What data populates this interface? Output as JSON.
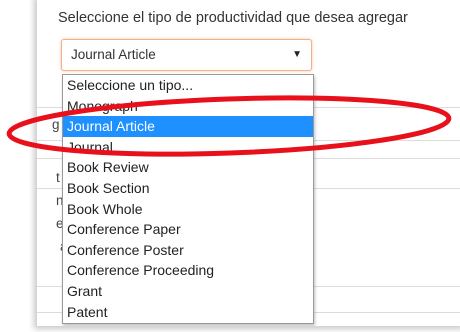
{
  "form": {
    "prompt": "Seleccione el tipo de productividad que desea agregar",
    "select": {
      "value": "Journal Article",
      "caret": "▼",
      "options": [
        "Seleccione un tipo...",
        "Monograph",
        "Journal Article",
        "Journal",
        "Book Review",
        "Book Section",
        "Book Whole",
        "Conference Paper",
        "Conference Poster",
        "Conference Proceeding",
        "Grant",
        "Patent"
      ],
      "highlighted_option": "Journal Article"
    },
    "background_fragments": {
      "frag1": "g",
      "frag2": "t",
      "frag3": "n",
      "frag4": "e",
      "frag5": "a"
    }
  },
  "annotation": {
    "shape": "ellipse",
    "color": "#e8101a"
  },
  "colors": {
    "selected_option_bg": "#1e90ff",
    "select_focus_border": "#f0b08a"
  }
}
